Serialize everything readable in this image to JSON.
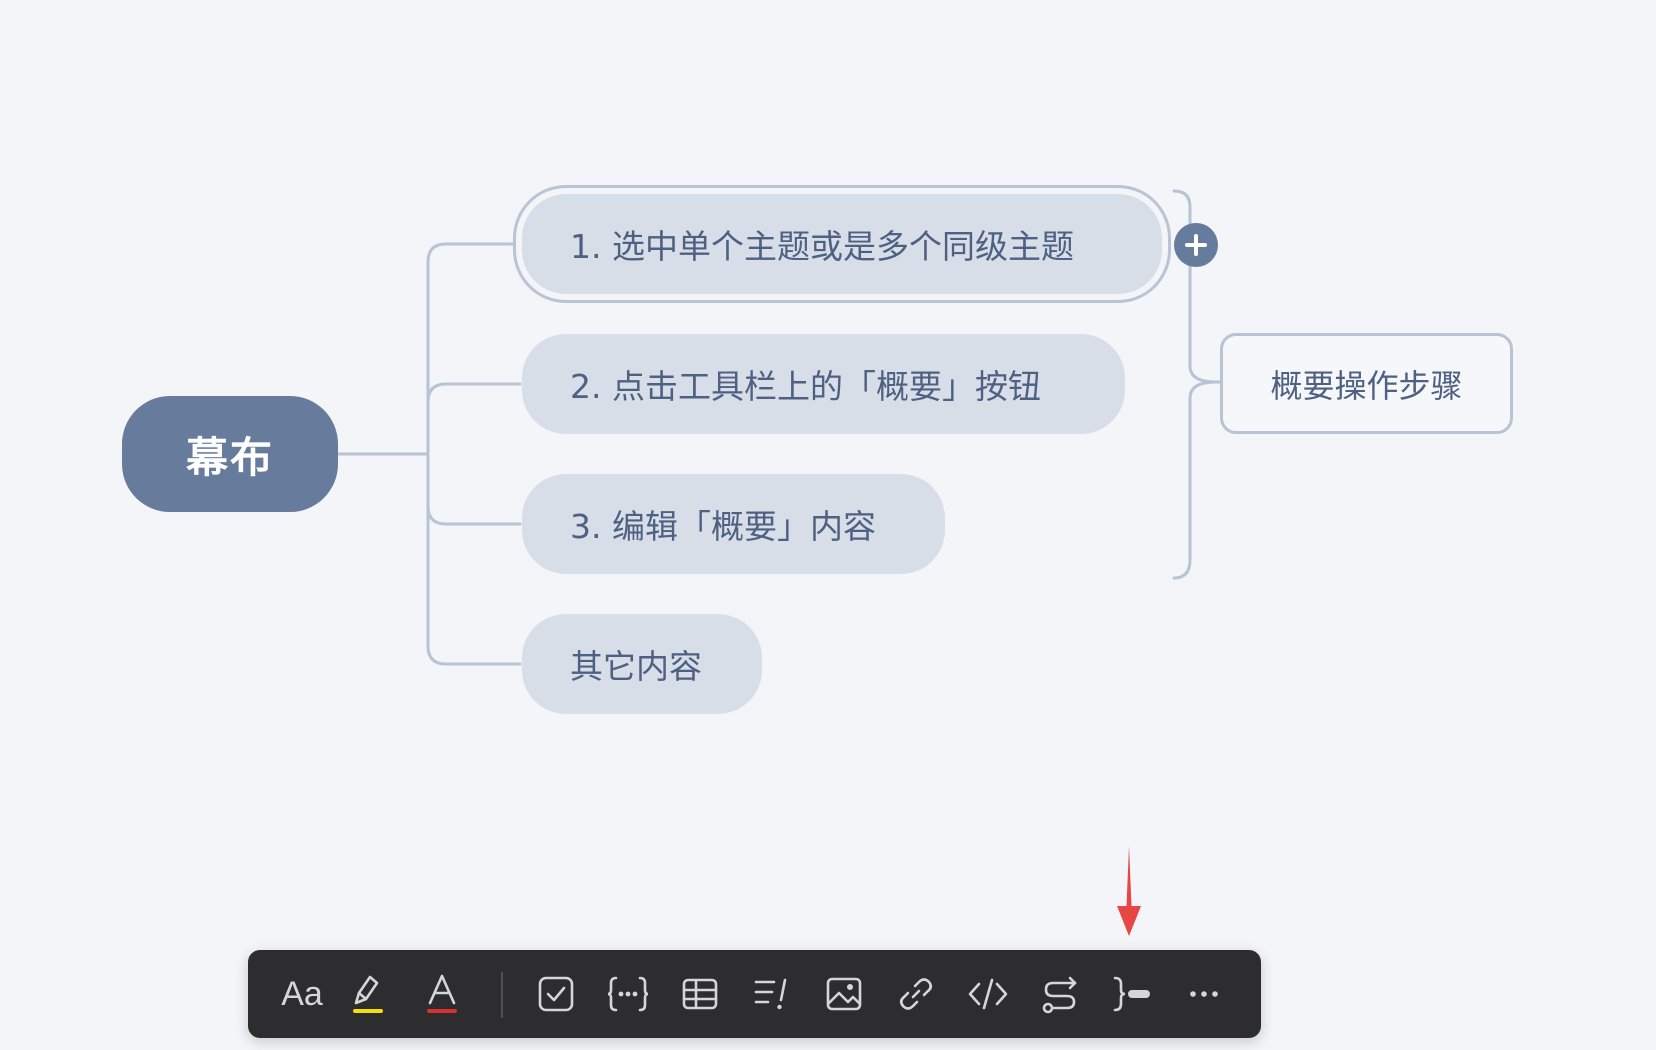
{
  "mindmap": {
    "root": {
      "label": "幕布",
      "color": "#677b9c"
    },
    "topics": [
      {
        "label": "1. 选中单个主题或是多个同级主题",
        "selected": true
      },
      {
        "label": "2. 点击工具栏上的「概要」按钮",
        "selected": false
      },
      {
        "label": "3. 编辑「概要」内容",
        "selected": false
      },
      {
        "label": "其它内容",
        "selected": false
      }
    ],
    "summary": {
      "label": "概要操作步骤",
      "covers_topics": [
        1,
        2,
        3
      ]
    },
    "add_button_icon": "plus-icon",
    "colors": {
      "topic_fill": "#d8dee8",
      "topic_text": "#4f6182",
      "line": "#b8c4d4",
      "background": "#f3f5f9"
    }
  },
  "annotation": {
    "icon": "red-arrow-down-icon",
    "color": "#e84545",
    "points_to": "summary-tool"
  },
  "toolbar": {
    "font_tool": {
      "label": "Aa",
      "icon": "font-style-icon"
    },
    "highlight_tool": {
      "icon": "highlighter-icon",
      "color": "#f5e000"
    },
    "text_color_tool": {
      "label": "A",
      "icon": "text-color-icon",
      "color": "#d8312b"
    },
    "tools": [
      {
        "name": "checkbox-tool",
        "icon": "checkbox-icon"
      },
      {
        "name": "expression-tool",
        "icon": "braces-ellipsis-icon"
      },
      {
        "name": "table-tool",
        "icon": "table-icon"
      },
      {
        "name": "priority-tool",
        "icon": "list-priority-icon"
      },
      {
        "name": "image-tool",
        "icon": "image-icon"
      },
      {
        "name": "link-tool",
        "icon": "link-icon"
      },
      {
        "name": "code-tool",
        "icon": "code-icon"
      },
      {
        "name": "relation-tool",
        "icon": "relation-icon"
      },
      {
        "name": "summary-tool",
        "icon": "summary-icon"
      },
      {
        "name": "more-tool",
        "icon": "more-icon"
      }
    ]
  }
}
